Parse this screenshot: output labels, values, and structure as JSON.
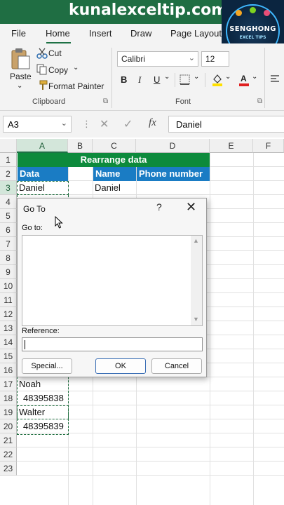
{
  "watermark": {
    "text": "kunalexceltip.com"
  },
  "logo": {
    "name": "SENGHONG",
    "sub": "EXCEL TIPS"
  },
  "ribbon": {
    "tabs": [
      "File",
      "Home",
      "Insert",
      "Draw",
      "Page Layout"
    ],
    "active_tab": "Home",
    "clipboard": {
      "paste": "Paste",
      "cut": "Cut",
      "copy": "Copy",
      "format_painter": "Format Painter",
      "group_label": "Clipboard"
    },
    "font": {
      "name": "Calibri",
      "size": "12",
      "bold": "B",
      "italic": "I",
      "underline": "U",
      "group_label": "Font"
    }
  },
  "formula_bar": {
    "name_box": "A3",
    "cancel": "✕",
    "enter": "✓",
    "fx": "fx",
    "content": "Daniel"
  },
  "grid": {
    "columns": [
      "A",
      "B",
      "C",
      "D",
      "E",
      "F"
    ],
    "rows": [
      "1",
      "2",
      "3",
      "4",
      "5",
      "6",
      "7",
      "8",
      "9",
      "10",
      "11",
      "12",
      "13",
      "14",
      "15",
      "16",
      "17",
      "18",
      "19",
      "20",
      "21",
      "22",
      "23"
    ],
    "header_banner": "Rearrange data",
    "A2": "Data",
    "C2": "Name",
    "D2": "Phone number",
    "A3": "Daniel",
    "C3": "Daniel",
    "A17": "Noah",
    "A18": "48395838",
    "A19": "Walter",
    "A20": "48395839"
  },
  "dialog": {
    "title": "Go To",
    "help": "?",
    "close": "✕",
    "goto_label": "Go to:",
    "reference_label": "Reference:",
    "reference_value": "",
    "special": "Special...",
    "ok": "OK",
    "cancel": "Cancel"
  }
}
